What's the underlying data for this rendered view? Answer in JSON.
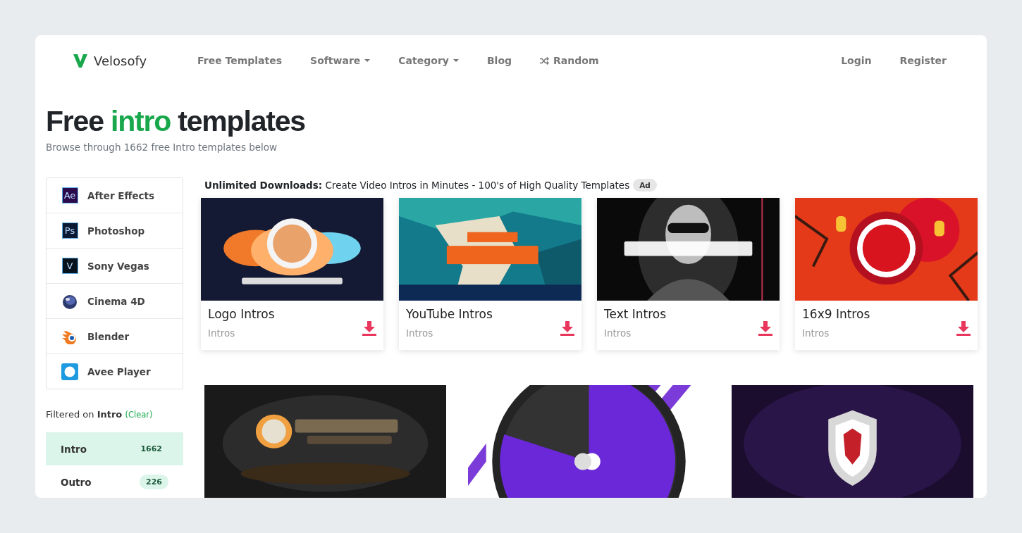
{
  "brand": {
    "name": "Velosofy"
  },
  "nav": [
    {
      "label": "Free Templates",
      "kind": "link"
    },
    {
      "label": "Software",
      "kind": "dropdown"
    },
    {
      "label": "Category",
      "kind": "dropdown"
    },
    {
      "label": "Blog",
      "kind": "link"
    },
    {
      "label": "Random",
      "kind": "shuffle"
    }
  ],
  "account": [
    "Login",
    "Register"
  ],
  "heading": {
    "before": "Free",
    "highlight": "intro",
    "after": "templates"
  },
  "subtitle": "Browse through 1662 free Intro templates below",
  "software": [
    {
      "label": "After Effects",
      "kind": "adobe",
      "mark": "Ae",
      "color": "#2a0a4a"
    },
    {
      "label": "Photoshop",
      "kind": "adobe",
      "mark": "Ps",
      "color": "#0a1a33"
    },
    {
      "label": "Sony Vegas",
      "kind": "adobe",
      "mark": "V",
      "color": "#06121c"
    },
    {
      "label": "Cinema 4D",
      "kind": "sphere"
    },
    {
      "label": "Blender",
      "kind": "blender"
    },
    {
      "label": "Avee Player",
      "kind": "avee"
    }
  ],
  "filter": {
    "prefix": "Filtered on",
    "value": "Intro",
    "clear": "(Clear)"
  },
  "categories": [
    {
      "label": "Intro",
      "count": "1662",
      "selected": true
    },
    {
      "label": "Outro",
      "count": "226",
      "selected": false
    }
  ],
  "ad": {
    "text": "**Unlimited Downloads:** Create Video Intros in Minutes - 100's of High Quality Templates",
    "badge": "Ad"
  },
  "templates": [
    {
      "title": "Logo Intros",
      "category": "Intros"
    },
    {
      "title": "YouTube Intros",
      "category": "Intros"
    },
    {
      "title": "Text Intros",
      "category": "Intros"
    },
    {
      "title": "16x9 Intros",
      "category": "Intros"
    }
  ],
  "previews": [
    {
      "kind": "picture"
    },
    {
      "kind": "picture"
    },
    {
      "kind": "picture"
    }
  ]
}
